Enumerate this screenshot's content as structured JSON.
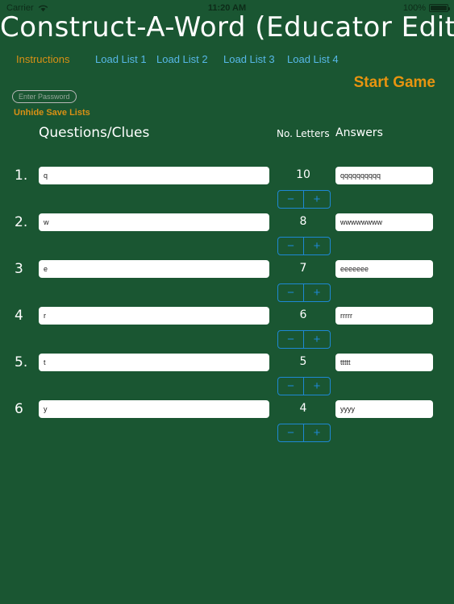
{
  "status_bar": {
    "carrier": "Carrier",
    "wifi_icon": "wifi-icon",
    "time": "11:20 AM",
    "battery_percent": "100%",
    "battery_icon": "battery-full-icon"
  },
  "header": {
    "title": "Construct-A-Word (Educator Edition)"
  },
  "nav": {
    "instructions": "Instructions",
    "load_list_1": "Load List 1",
    "load_list_2": "Load List 2",
    "load_list_3": "Load List 3",
    "load_list_4": "Load List 4",
    "instructions_color": "#d99015",
    "load_list_color": "#57b8e8"
  },
  "toolbar": {
    "password_placeholder": "Enter Password",
    "password_value": "",
    "unhide_label": "Unhide Save Lists",
    "start_game_label": "Start Game",
    "start_game_color": "#e89410"
  },
  "columns": {
    "questions": "Questions/Clues",
    "letters": "No. Letters",
    "answers": "Answers"
  },
  "stepper": {
    "minus_label": "−",
    "plus_label": "+",
    "accent_color": "#1e88d4"
  },
  "rows": [
    {
      "number": "1.",
      "clue": "q",
      "letters": "10",
      "answer": "qqqqqqqqqq"
    },
    {
      "number": "2.",
      "clue": "w",
      "letters": "8",
      "answer": "wwwwwwww"
    },
    {
      "number": "3",
      "clue": "e",
      "letters": "7",
      "answer": "eeeeeee"
    },
    {
      "number": "4",
      "clue": "r",
      "letters": "6",
      "answer": "rrrrr"
    },
    {
      "number": "5.",
      "clue": "t",
      "letters": "5",
      "answer": "ttttt"
    },
    {
      "number": "6",
      "clue": "y",
      "letters": "4",
      "answer": "yyyy"
    }
  ],
  "theme": {
    "background": "#1a5632",
    "input_background": "#ffffff",
    "text_color": "#ffffff"
  }
}
